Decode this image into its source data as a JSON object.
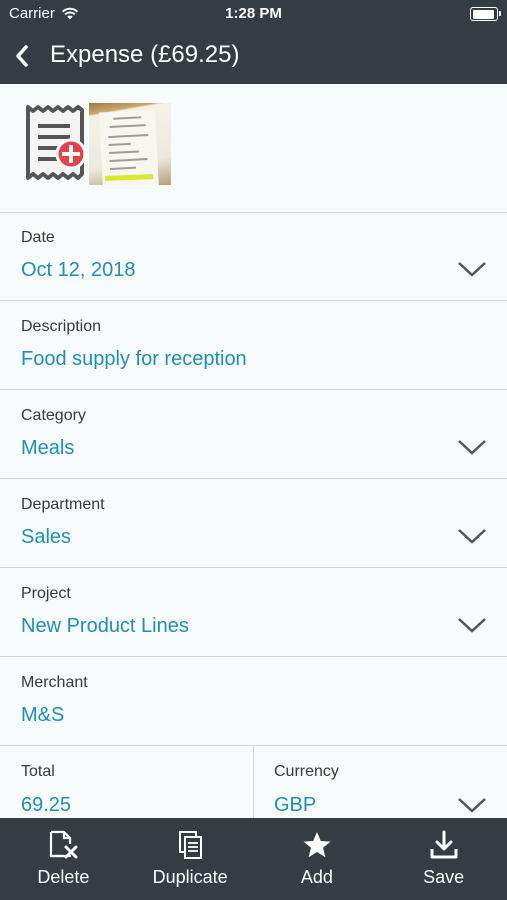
{
  "status": {
    "carrier": "Carrier",
    "time": "1:28 PM"
  },
  "nav": {
    "title": "Expense (£69.25)"
  },
  "fields": [
    {
      "label": "Date",
      "value": "Oct 12, 2018",
      "dropdown": true
    },
    {
      "label": "Description",
      "value": "Food supply for reception",
      "dropdown": false
    },
    {
      "label": "Category",
      "value": "Meals",
      "dropdown": true
    },
    {
      "label": "Department",
      "value": "Sales",
      "dropdown": true
    },
    {
      "label": "Project",
      "value": "New Product Lines",
      "dropdown": true
    },
    {
      "label": "Merchant",
      "value": "M&S",
      "dropdown": false
    }
  ],
  "total": {
    "label": "Total",
    "value": "69.25"
  },
  "currency": {
    "label": "Currency",
    "value": "GBP"
  },
  "toolbar": {
    "delete": "Delete",
    "duplicate": "Duplicate",
    "add": "Add",
    "save": "Save"
  },
  "colors": {
    "bar": "#353c44",
    "accent": "#1e8fbd",
    "badge": "#e8414b",
    "background": "#f8fbfb"
  }
}
